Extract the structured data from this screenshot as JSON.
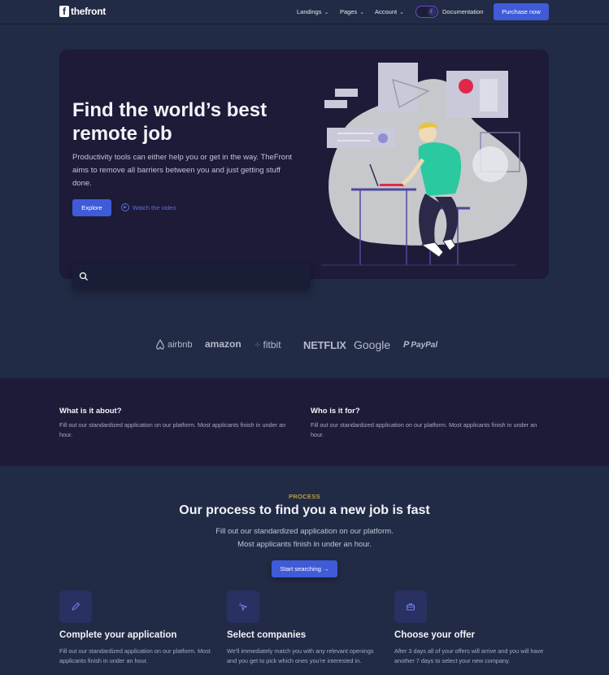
{
  "header": {
    "logo_mark": "f",
    "logo_text": "thefront",
    "nav": [
      {
        "label": "Landings",
        "icon": "chevron-down-icon"
      },
      {
        "label": "Pages",
        "icon": "chevron-down-icon"
      },
      {
        "label": "Account",
        "icon": "chevron-down-icon"
      }
    ],
    "theme_toggle_icon": "moon-icon",
    "documentation": "Documentation",
    "purchase": "Purchase now"
  },
  "hero": {
    "title": "Find the world’s best remote job",
    "subtitle": "Productivity tools can either help you or get in the way. TheFront aims to remove all barriers between you and just getting stuff done.",
    "explore": "Explore",
    "watch_video": "Watch the video",
    "search_placeholder": ""
  },
  "brands": [
    "airbnb",
    "amazon",
    "fitbit",
    "NETFLIX",
    "Google",
    "PayPal"
  ],
  "about": [
    {
      "title": "What is it about?",
      "text": "Fill out our standardized application on our platform. Most applicants finish in under an hour."
    },
    {
      "title": "Who is it for?",
      "text": "Fill out our standardized application on our platform. Most applicants finish in under an hour."
    }
  ],
  "process": {
    "eyebrow": "PROCESS",
    "title": "Our process to find you a new job is fast",
    "subtitle_line1": "Fill out our standardized application on our platform.",
    "subtitle_line2": "Most applicants finish in under an hour.",
    "button": "Start searching →",
    "steps": [
      {
        "title": "Complete your application",
        "text": "Fill out our standardized application on our platform. Most applicants finish in under an hour.",
        "icon": "pencil-icon"
      },
      {
        "title": "Select companies",
        "text": "We'll immediately match you with any relevant openings and you get to pick which ones you're interested in.",
        "icon": "cursor-click-icon"
      },
      {
        "title": "Choose your offer",
        "text": "After 3 days all of your offers will arrive and you will have another 7 days to select your new company.",
        "icon": "briefcase-icon"
      }
    ]
  },
  "colors": {
    "accent": "#3f5bd8",
    "background": "#222b45",
    "panel": "#1d1b38",
    "highlight": "#f4d03f"
  }
}
